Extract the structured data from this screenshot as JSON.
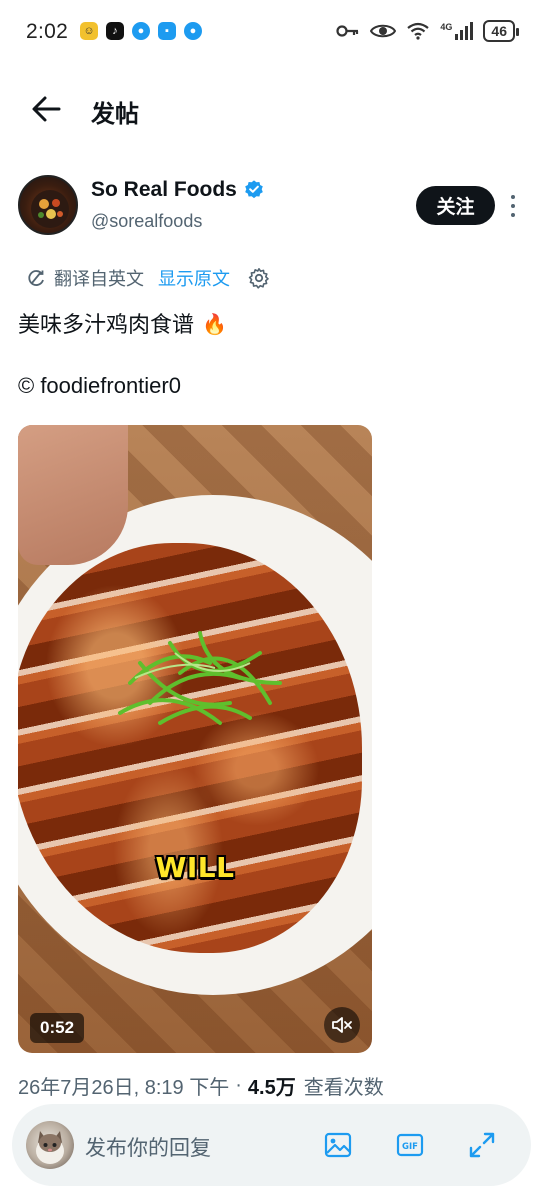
{
  "status_bar": {
    "time": "2:02",
    "signal_label": "4G",
    "battery": "46"
  },
  "header": {
    "title": "发帖"
  },
  "post": {
    "author": {
      "name": "So Real Foods",
      "handle": "@sorealfoods",
      "verified": true
    },
    "follow_label": "关注",
    "translation": {
      "from_label": "翻译自英文",
      "show_original_label": "显示原文"
    },
    "text": "美味多汁鸡肉食谱",
    "credit": "© foodiefrontier0",
    "video": {
      "caption": "WILL",
      "duration": "0:52"
    },
    "meta": {
      "date_time": "26年7月26日, 8:19 下午",
      "separator": "·",
      "views": "4.5万",
      "views_label": "查看次数"
    }
  },
  "reply_bar": {
    "placeholder": "发布你的回复"
  },
  "colors": {
    "accent": "#1d9bf0",
    "text_primary": "#0f1419",
    "text_secondary": "#536471",
    "reply_bar_bg": "#eff3f4",
    "caption_yellow": "#ffe629"
  }
}
